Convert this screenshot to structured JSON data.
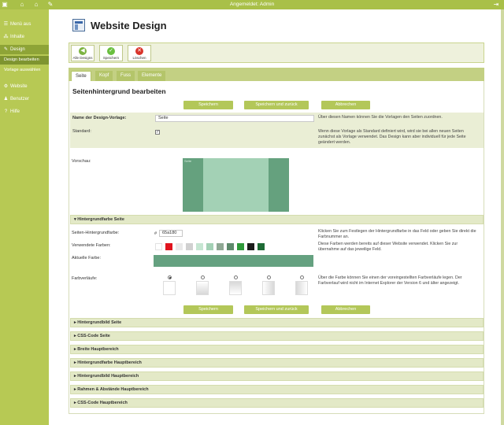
{
  "topbar": {
    "status": "Angemeldet: Admin"
  },
  "sidebar": {
    "items": [
      {
        "label": "Menü aus",
        "icon": "menu-icon"
      },
      {
        "label": "Inhalte",
        "icon": "sitemap-icon"
      },
      {
        "label": "Design",
        "icon": "design-icon"
      },
      {
        "label": "Website",
        "icon": "gear-icon"
      },
      {
        "label": "Benutzer",
        "icon": "users-icon"
      },
      {
        "label": "Hilfe",
        "icon": "help-icon"
      }
    ],
    "subitems": [
      {
        "label": "Design bearbeiten"
      },
      {
        "label": "Vorlage auswählen"
      }
    ]
  },
  "page": {
    "title": "Website Design"
  },
  "toolbar": {
    "all_designs": "Alle Designs",
    "save": "Speichern",
    "delete": "Löschen"
  },
  "tabs": [
    "Seite",
    "Kopf",
    "Fuss",
    "Elemente"
  ],
  "section_title": "Seitenhintergrund bearbeiten",
  "buttons": {
    "save": "Speichern",
    "save_back": "Speichern und zurück",
    "cancel": "Abbrechen"
  },
  "form": {
    "name_label": "Name der Design-Vorlage:",
    "name_value": "Seite",
    "name_help": "Über diesen Namen können Sie die Vorlagen den Seiten zuordnen.",
    "standard_label": "Standard:",
    "standard_checked": "✓",
    "standard_help": "Wenn diese Vorlage als Standard definiert wird, wird sie bei allen neuen Seiten zunächst als Vorlage verwendet. Das Design kann aber individuell für jede Seite geändert werden.",
    "preview_label": "Vorschau:",
    "preview_text": "Seite"
  },
  "bgcolor": {
    "header": "Hintergrundfarbe Seite",
    "color_label": "Seiten-Hintergrundfarbe:",
    "hash": "#",
    "color_value": "65a180",
    "color_help": "Klicken Sie zum Festlegen der Hintergrundfarbe in das Feld oder geben Sie direkt die Farbnummer an.",
    "used_label": "Verwendete Farben:",
    "used_help": "Diese Farben werden bereits auf dieser Website verwendet. Klicken Sie zur übernahme auf das jeweilige Feld.",
    "used_colors": [
      "#ffffff",
      "#e0141e",
      "#e9e9e9",
      "#d0d0d0",
      "#c6e6d2",
      "#a3d1b5",
      "#8fa894",
      "#5e8a6c",
      "#2f9a3a",
      "#1c1c1c",
      "#1e6b35"
    ],
    "current_label": "Aktuelle Farbe:",
    "current_color": "#65a180",
    "gradient_label": "Farbverläufe:",
    "gradient_help": "Über die Farbe können Sie einen der voreingestellten Farbverläufe legen. Der Farbverlauf wird nicht im Internet Explorer der Version 6 und älter angezeigt."
  },
  "accordions": [
    "Hintergrundbild Seite",
    "CSS-Code Seite",
    "Breite Hauptbereich",
    "Hintergrundfarbe Hauptbereich",
    "Hintergrundbild Hauptbereich",
    "Rahmen & Abstände Hauptbereich",
    "CSS-Code Hauptbereich"
  ]
}
